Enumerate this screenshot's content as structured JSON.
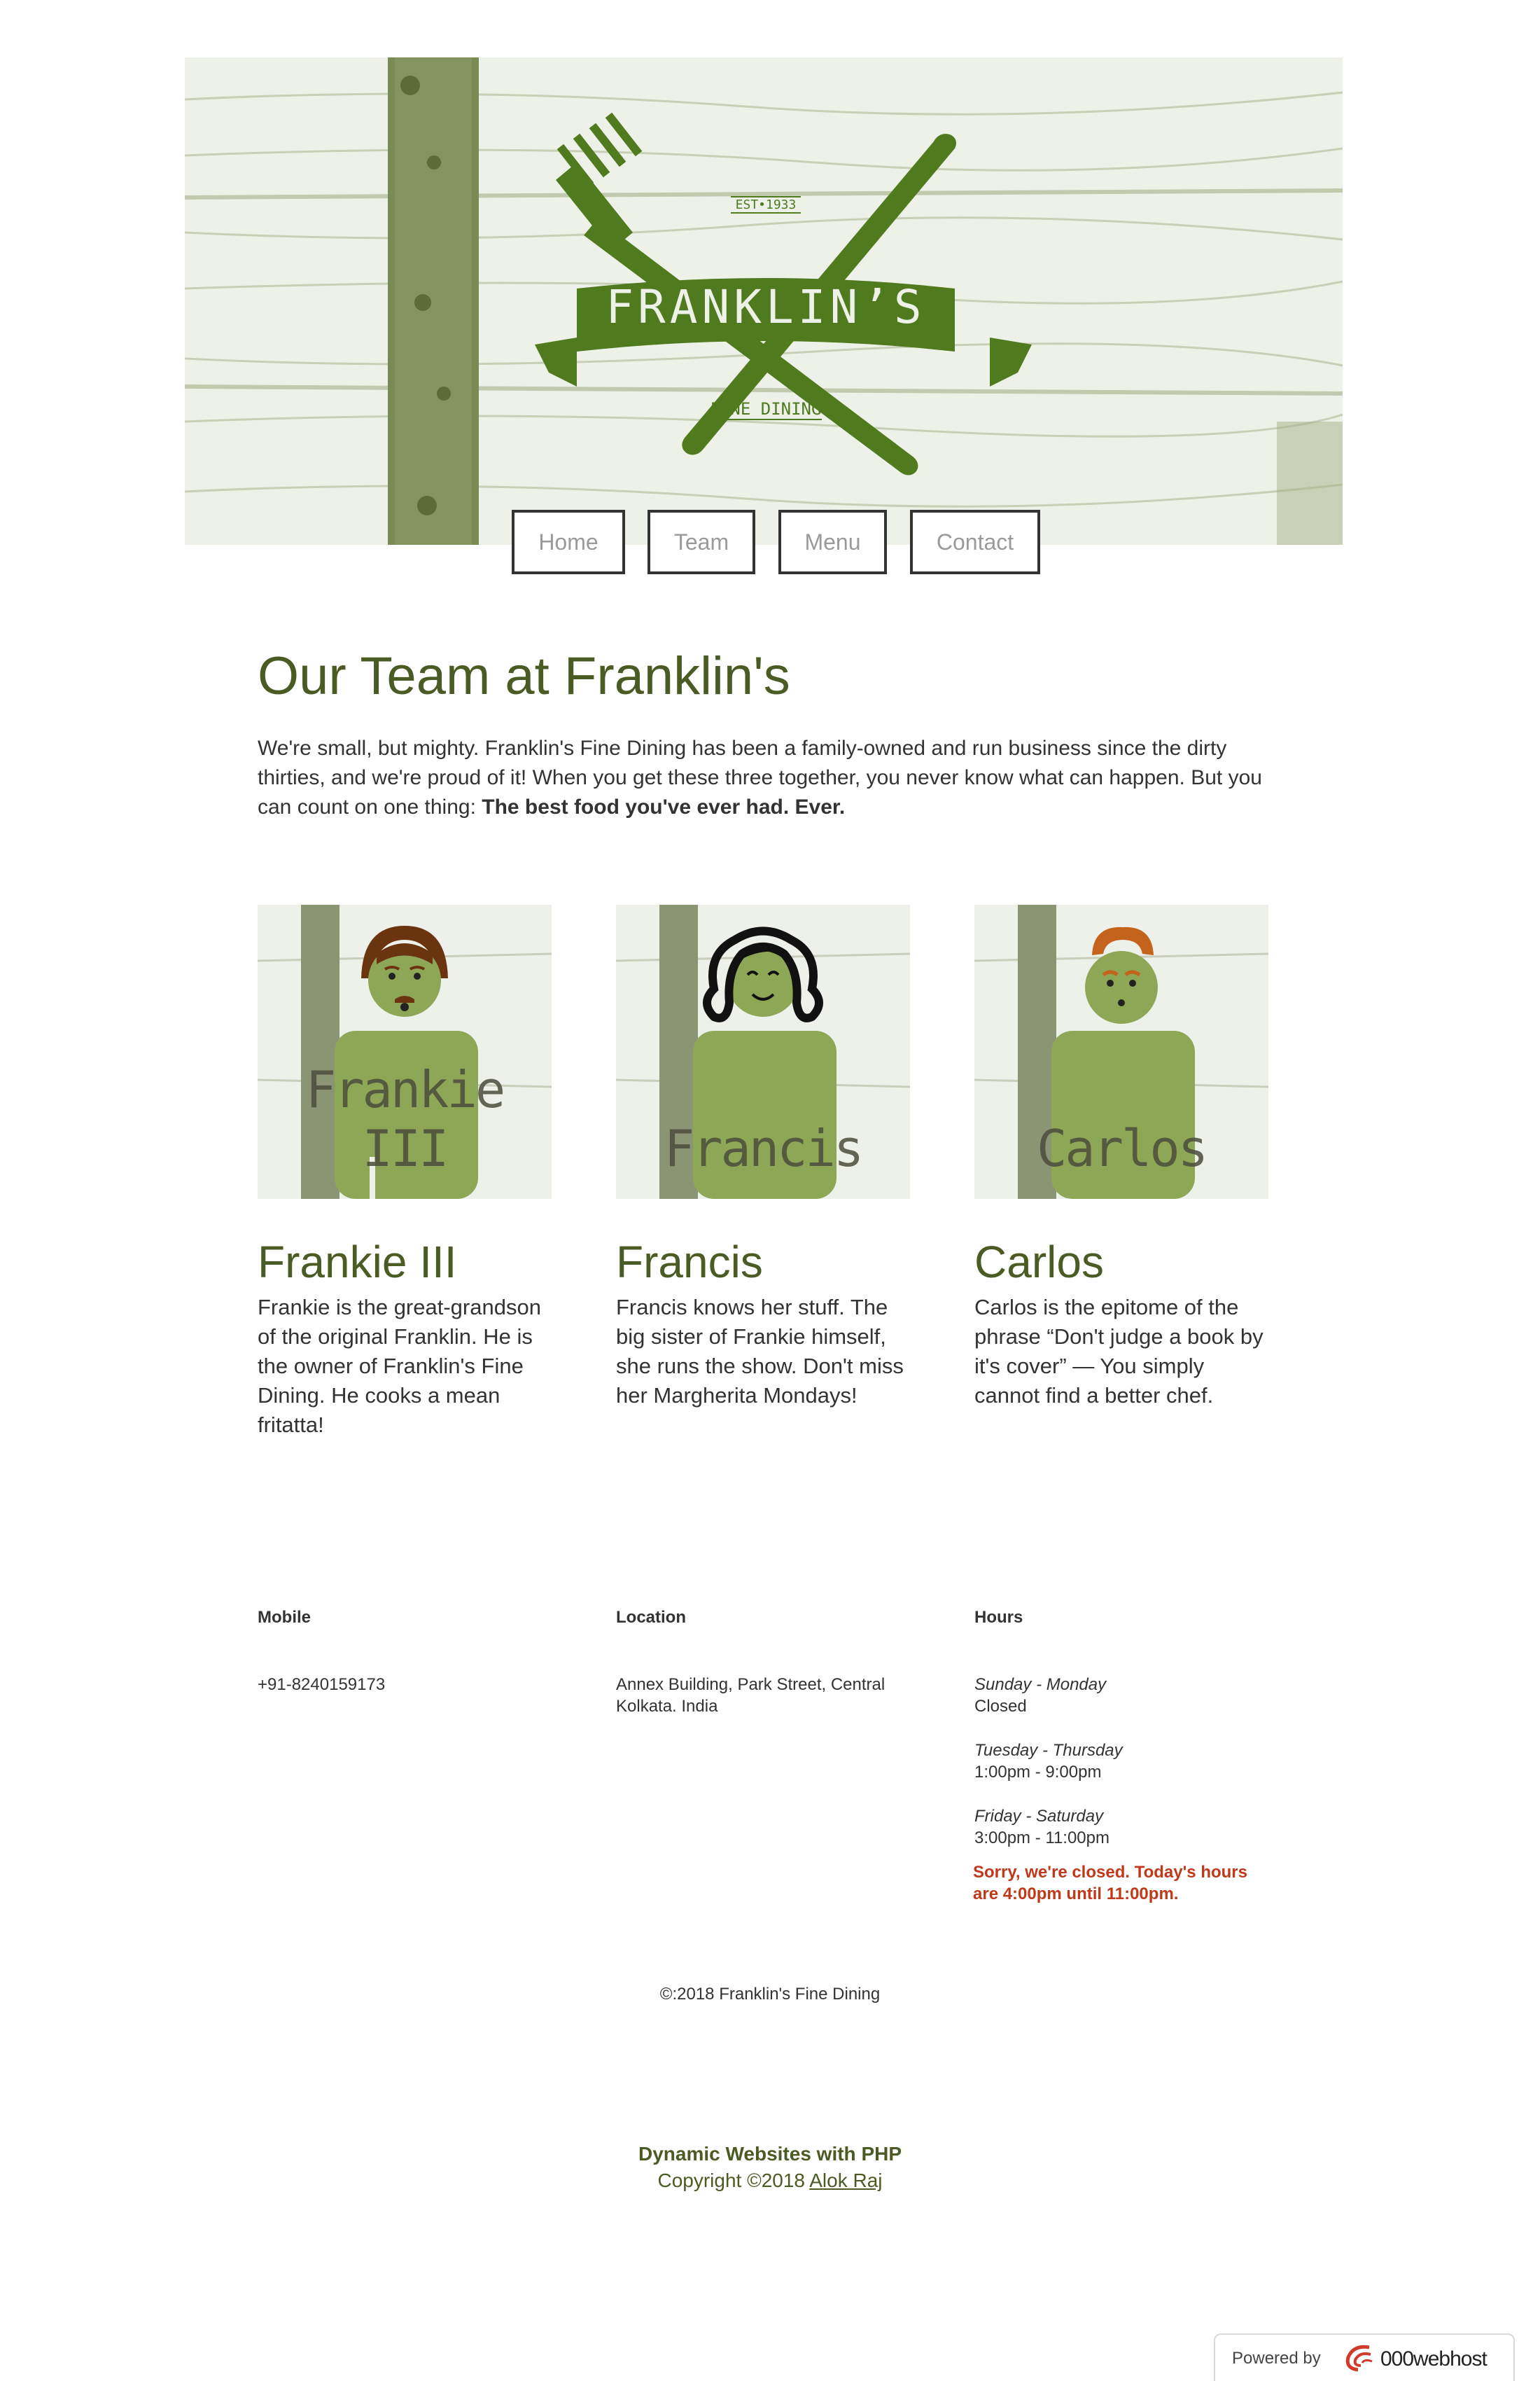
{
  "brand": {
    "name": "FRANKLIN’S",
    "est": "EST•1933",
    "tagline": "FINE DINING",
    "color_primary": "#4b5b24",
    "color_logo": "#4f7a1e"
  },
  "nav": {
    "items": [
      "Home",
      "Team",
      "Menu",
      "Contact"
    ]
  },
  "page": {
    "title": "Our Team at Franklin's",
    "intro": "We're small, but mighty. Franklin's Fine Dining has been a family-owned and run business since the dirty thirties, and we're proud of it! When you get these three together, you never know what can happen. But you can count on one thing:",
    "intro_bold": "The best food you've ever had. Ever."
  },
  "team": [
    {
      "name": "Frankie III",
      "portrait_label": "Frankie III",
      "bio": "Frankie is the great-grandson of the original Franklin. He is the owner of Franklin's Fine Dining. He cooks a mean fritatta!"
    },
    {
      "name": "Francis",
      "portrait_label": "Francis",
      "bio": "Francis knows her stuff. The big sister of Frankie himself, she runs the show. Don't miss her Margherita Mondays!"
    },
    {
      "name": "Carlos",
      "portrait_label": "Carlos",
      "bio": "Carlos is the epitome of the phrase “Don't judge a book by it's cover” — You simply cannot find a better chef."
    }
  ],
  "info": {
    "mobile": {
      "heading": "Mobile",
      "value": "+91-8240159173"
    },
    "location": {
      "heading": "Location",
      "line1": "Annex Building, Park Street, Central",
      "line2": "Kolkata. India"
    },
    "hours": {
      "heading": "Hours",
      "rows": [
        {
          "days": "Sunday - Monday",
          "time": "Closed"
        },
        {
          "days": "Tuesday - Thursday",
          "time": "1:00pm - 9:00pm"
        },
        {
          "days": "Friday - Saturday",
          "time": "3:00pm - 11:00pm"
        }
      ],
      "status_line1": "Sorry, we're closed. Today's hours",
      "status_line2": "are 4:00pm until 11:00pm.",
      "status_color": "#c0391b"
    }
  },
  "footer": {
    "copyright": "©:2018 Franklin's Fine Dining",
    "site_title": "Dynamic Websites with PHP",
    "site_copy_prefix": "Copyright ©2018",
    "author": "Alok Raj"
  },
  "badge": {
    "powered_by": "Powered by",
    "brand": "000webhost"
  },
  "icons": {
    "logo": "fork-knife-crossed-icon",
    "badge_logo": "000webhost-swirl-icon"
  }
}
